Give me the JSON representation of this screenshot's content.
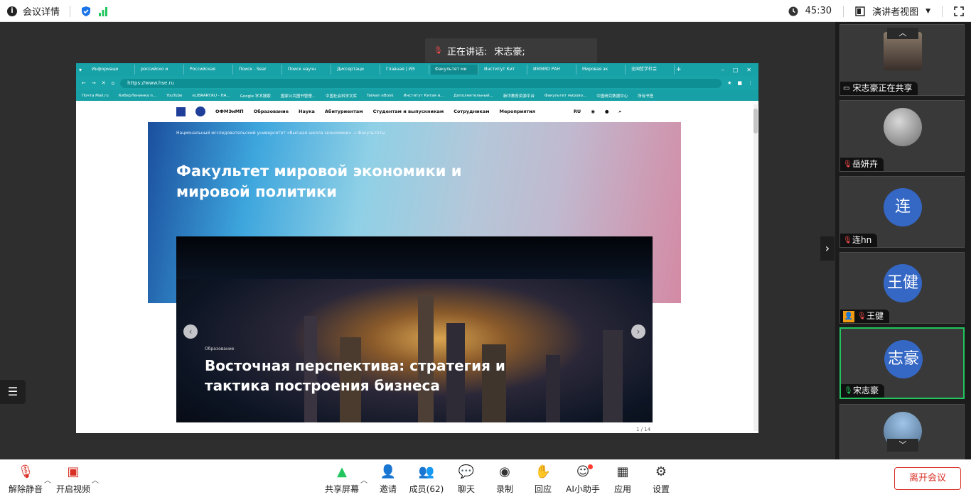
{
  "topbar": {
    "meeting_info": "会议详情",
    "timer": "45:30",
    "view_mode": "演讲者视图"
  },
  "speaking": {
    "label": "正在讲话:",
    "name": "宋志豪;"
  },
  "browser": {
    "tabs": [
      "Информаци",
      "российско и",
      "Российская",
      "Поиск - Sear",
      "Поиск научн",
      "Диссертаци",
      "Главная | ИЭ",
      "Факультет ми",
      "Институт Кит",
      "ИМЭМО РАН",
      "Мировая эк",
      "全国哲学社会"
    ],
    "url": "https://www.hse.ru",
    "bookmarks": [
      "Почта Mail.ru",
      "КиберЛенинка п...",
      "YouTube",
      "eLIBRARY.RU - НА...",
      "Google 学术搜索",
      "国家公共图书管理...",
      "中国社会科学文库",
      "Taiwan eBook",
      "Институт Китая и...",
      "Дополнительный...",
      "新华教育资源平台",
      "Факультет мирово...",
      "中国研究数据中心",
      "所有书签"
    ]
  },
  "site": {
    "nav": [
      "ОФМЭиМП",
      "Образование",
      "Наука",
      "Абитуриентам",
      "Студентам и выпускникам",
      "Сотрудникам",
      "Мероприятия",
      "RU"
    ],
    "breadcrumb": "Национальный исследовательский университет «Высшая школа экономики»  →  Факультеты",
    "hero_title": "Факультет мировой экономики и мировой политики",
    "slide_tag": "Образование",
    "slide_caption": "Восточная перспектива: стратегия и тактика построения бизнеса",
    "page_count": "1 / 14"
  },
  "participants": [
    {
      "name": "宋志豪正在共享",
      "avatar": "",
      "type": "photo",
      "status": "sharing"
    },
    {
      "name": "岳妍卉",
      "avatar": "",
      "type": "photo",
      "status": "muted"
    },
    {
      "name": "连hn",
      "avatar": "连",
      "type": "initial",
      "status": "muted"
    },
    {
      "name": "王健",
      "avatar": "王健",
      "type": "initial",
      "status": "muted-host"
    },
    {
      "name": "宋志豪",
      "avatar": "志豪",
      "type": "initial",
      "status": "speaking"
    },
    {
      "name": "",
      "avatar": "",
      "type": "photo",
      "status": "none"
    }
  ],
  "toolbar": {
    "unmute": "解除静音",
    "video": "开启视频",
    "share": "共享屏幕",
    "invite": "邀请",
    "members": "成员(62)",
    "chat": "聊天",
    "record": "录制",
    "replay": "回应",
    "ai": "AI小助手",
    "apps": "应用",
    "settings": "设置",
    "leave": "离开会议"
  },
  "colors": {
    "accent_green": "#22c55e",
    "avatar_blue": "#3567c4",
    "leave_red": "#d93025",
    "browser_teal": "#17a2a8"
  }
}
